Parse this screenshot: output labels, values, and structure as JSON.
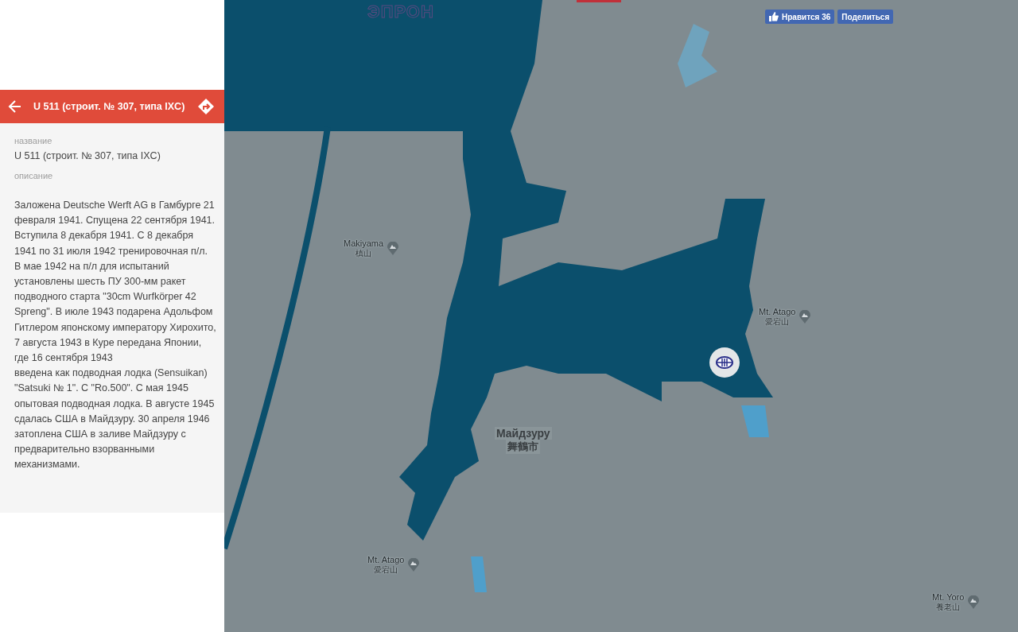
{
  "header": {
    "title": "U 511 (строит. № 307, типа IXC)"
  },
  "fields": [
    {
      "kind": "short",
      "label": "название",
      "value": "U 511 (строит. № 307, типа IXC)"
    },
    {
      "kind": "long",
      "label": "описание",
      "paragraphs": [
        "Заложена Deutsche Werft AG в Гамбурге 21 февраля 1941. Спущена 22 сентября 1941. Вступила 8 декабря 1941. С 8 декабря 1941 по 31 июля 1942 тренировочная п/л. В мае 1942 на п/л для испытаний установлены шесть ПУ 300-мм ракет подводного старта \"30cm Wurfkörper 42 Spreng\". В июле 1943 подарена Адольфом Гитлером японскому императору Хирохито, 7 августа 1943 в Куре передана Японии, где 16 сентября 1943",
        "введена как подводная лодка (Sensuikan) \"Satsuki № 1\". С \"Ro.500\". С мая 1945 опытовая подводная лодка. В августе 1945 сдалась США в Майдзуру. 30 апреля 1946 затоплена США в заливе Майдзуру с предварительно взорванными механизмами."
      ]
    }
  ],
  "map": {
    "overlay_title": "ЭПРОН",
    "places": [
      {
        "kind": "mountain",
        "name": "Makiyama",
        "local_name": "槙山"
      },
      {
        "kind": "mountain",
        "name": "Mt. Atago",
        "local_name": "愛宕山"
      },
      {
        "kind": "city",
        "name": "Майдзуру",
        "local_name": "舞鶴市"
      },
      {
        "kind": "mountain",
        "name": "Mt. Atago",
        "local_name": "愛宕山"
      },
      {
        "kind": "mountain",
        "name": "Mt. Yoro",
        "local_name": "養老山"
      }
    ]
  },
  "social": {
    "like_label": "Нравится",
    "like_count": "36",
    "share_label": "Поделиться"
  }
}
